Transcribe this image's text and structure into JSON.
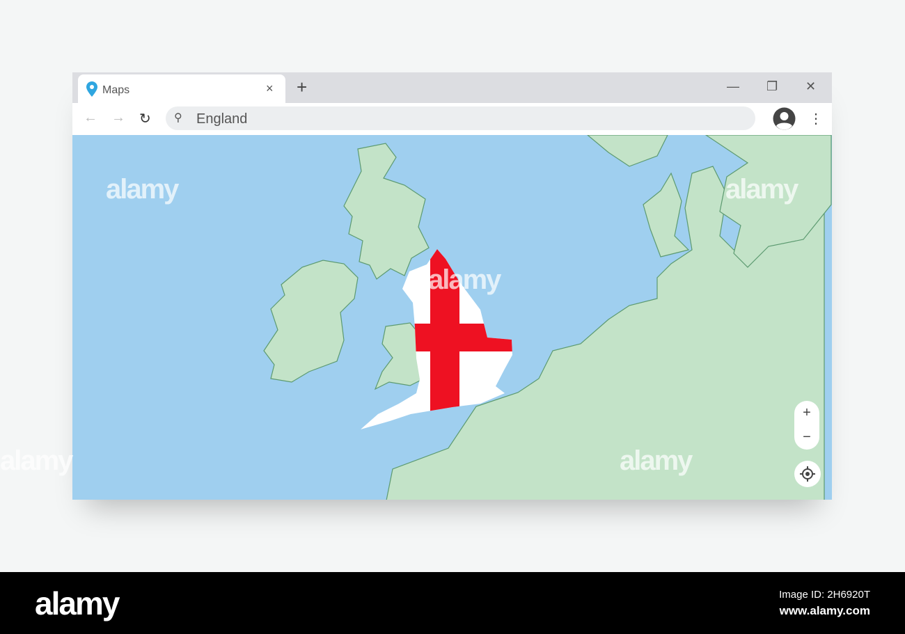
{
  "browser": {
    "tab_title": "Maps",
    "search_value": "England",
    "new_tab": "+",
    "close_tab": "×"
  },
  "map": {
    "highlighted_country": "England",
    "zoom_in": "+",
    "zoom_out": "−"
  },
  "colors": {
    "water": "#9fcfef",
    "land": "#c3e3c8",
    "flag_red": "#ee1122"
  },
  "footer": {
    "logo": "alamy",
    "image_id": "Image ID: 2H6920T",
    "website": "www.alamy.com"
  },
  "watermark": "alamy"
}
